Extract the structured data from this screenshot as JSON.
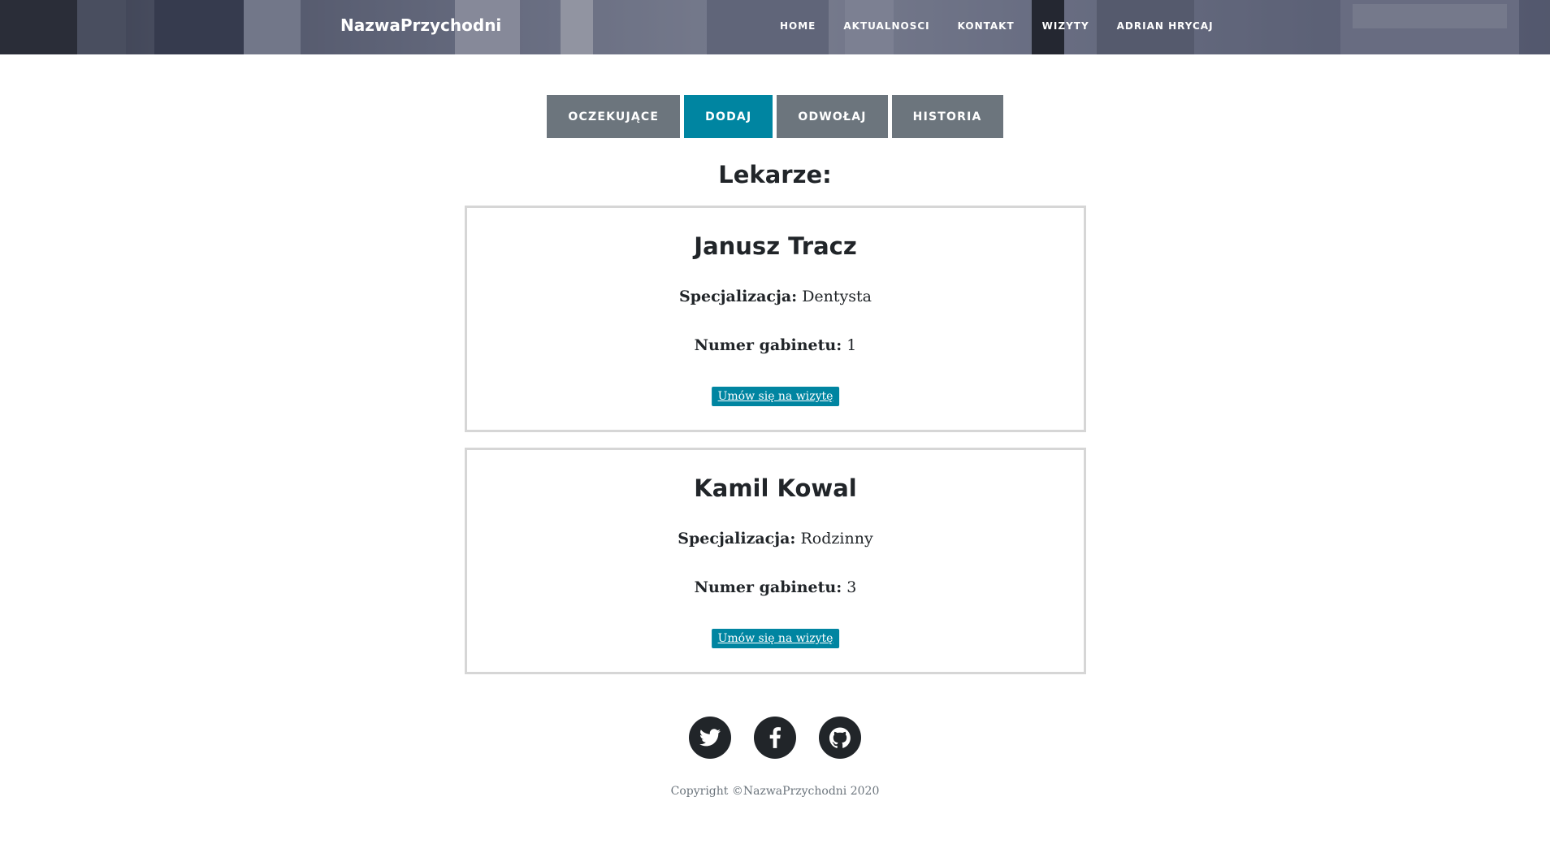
{
  "navbar": {
    "brand": "NazwaPrzychodni",
    "links": [
      "HOME",
      "AKTUALNOSCI",
      "KONTAKT",
      "WIZYTY",
      "ADRIAN HRYCAJ"
    ]
  },
  "tabs": [
    {
      "label": "OCZEKUJĄCE",
      "active": false
    },
    {
      "label": "DODAJ",
      "active": true
    },
    {
      "label": "ODWOŁAJ",
      "active": false
    },
    {
      "label": "HISTORIA",
      "active": false
    }
  ],
  "section_title": "Lekarze:",
  "doctors": [
    {
      "name": "Janusz Tracz",
      "spec_label": "Specjalizacja:",
      "spec_value": "Dentysta",
      "room_label": "Numer gabinetu:",
      "room_value": "1",
      "button": "Umów się na wizytę"
    },
    {
      "name": "Kamil Kowal",
      "spec_label": "Specjalizacja:",
      "spec_value": "Rodzinny",
      "room_label": "Numer gabinetu:",
      "room_value": "3",
      "button": "Umów się na wizytę"
    }
  ],
  "footer": {
    "social": [
      "twitter-icon",
      "facebook-icon",
      "github-icon"
    ],
    "copyright": "Copyright ©NazwaPrzychodni 2020"
  },
  "colors": {
    "accent": "#0085a1",
    "tab_inactive": "#6c757d",
    "text": "#212529",
    "muted": "#6c757d",
    "card_border": "#d6d6d6"
  }
}
